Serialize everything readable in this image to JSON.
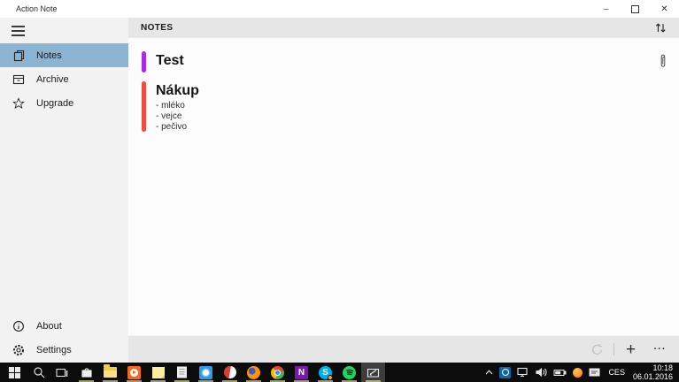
{
  "window": {
    "title": "Action Note",
    "controls": {
      "minimize": "–",
      "close": "✕"
    }
  },
  "sidebar": {
    "selected_color": "#8bb4d3",
    "items": [
      {
        "label": "Notes",
        "icon": "notes-icon",
        "selected": true
      },
      {
        "label": "Archive",
        "icon": "archive-icon",
        "selected": false
      },
      {
        "label": "Upgrade",
        "icon": "star-icon",
        "selected": false
      }
    ],
    "footer_items": [
      {
        "label": "About",
        "icon": "info-icon"
      },
      {
        "label": "Settings",
        "icon": "gear-icon"
      }
    ]
  },
  "main": {
    "header": {
      "title": "NOTES",
      "sort_icon": "sort-icon"
    },
    "notes": [
      {
        "title": "Test",
        "accent_color": "#a72ce6",
        "has_attachment": true,
        "items": []
      },
      {
        "title": "Nákup",
        "accent_color": "#f14b42",
        "has_attachment": false,
        "items": [
          "- mléko",
          "- vejce",
          "- pečivo"
        ]
      }
    ],
    "command_bar": {
      "refresh_icon": "refresh-icon",
      "add_label": "+",
      "more_label": "···"
    }
  },
  "taskbar": {
    "apps": [
      "start",
      "search",
      "task-view",
      "store",
      "file-explorer",
      "media-player",
      "sticky-notes",
      "calculator",
      "weather",
      "red-app",
      "firefox",
      "chrome",
      "onenote",
      "skype",
      "spotify",
      "action-note"
    ],
    "active_app": "action-note",
    "onenote_letter": "N",
    "skype_letter": "S",
    "tray": {
      "language": "CES",
      "time": "10:18",
      "date": "06.01.2016"
    }
  }
}
